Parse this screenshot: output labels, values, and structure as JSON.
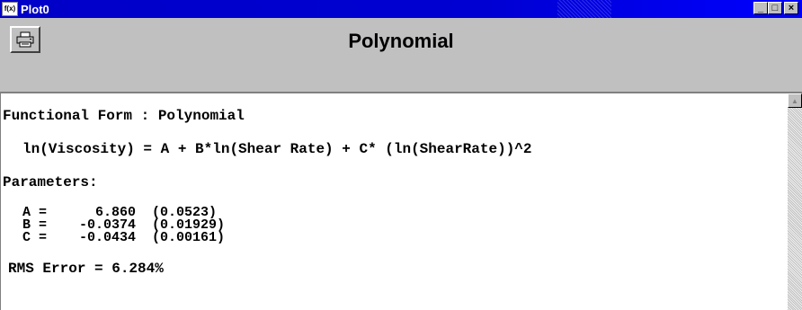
{
  "window": {
    "icon_text": "f(x)",
    "title": "Plot0",
    "minimize_glyph": "_",
    "maximize_glyph": "□",
    "close_glyph": "×"
  },
  "header": {
    "title": "Polynomial"
  },
  "content": {
    "functional_form_line": "Functional Form : Polynomial",
    "equation_line": "ln(Viscosity) = A + B*ln(Shear Rate) + C* (ln(ShearRate))^2",
    "parameters_label": "Parameters:",
    "parameters": [
      {
        "row": "A =      6.860  (0.0523)"
      },
      {
        "row": "B =    -0.0374  (0.01929)"
      },
      {
        "row": "C =    -0.0434  (0.00161)"
      }
    ],
    "rms_line": "RMS Error = 6.284%"
  },
  "scrollbar": {
    "up_glyph": "▲"
  },
  "colors": {
    "titlebar": "#0000c8",
    "chrome": "#c0c0c0",
    "content_bg": "#ffffff"
  }
}
